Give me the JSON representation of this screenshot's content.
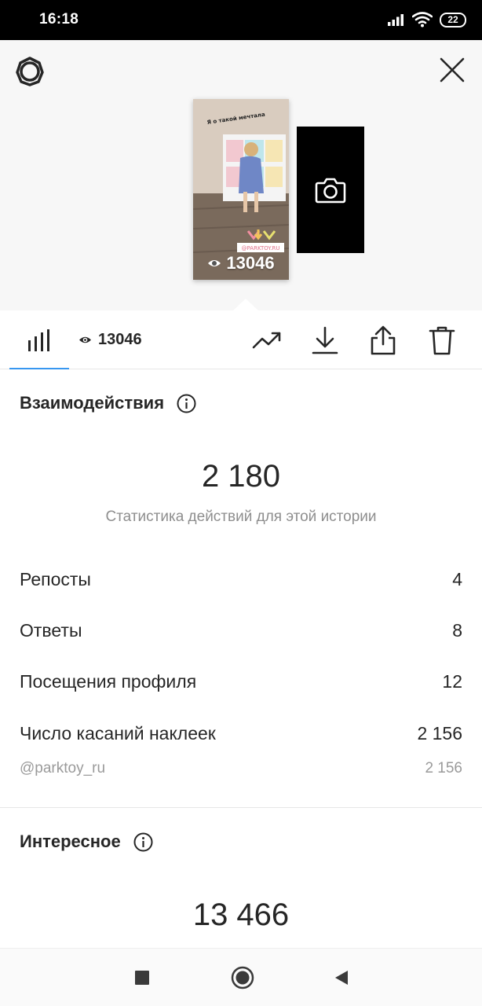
{
  "status_bar": {
    "time": "16:18",
    "battery": "22",
    "icons": [
      "signal-icon",
      "wifi-icon",
      "battery-icon"
    ]
  },
  "preview": {
    "story_views": "13046",
    "sticker_text": "@PARKTOY.RU",
    "caption_text": "Я о такой мечтала",
    "settings_icon": "gear-icon",
    "close_icon": "close-icon",
    "add_icon": "camera-icon"
  },
  "toolbar": {
    "stats_icon": "bar-chart-icon",
    "views_icon": "eye-icon",
    "views_count": "13046",
    "actions": [
      "trending-icon",
      "download-icon",
      "share-icon",
      "trash-icon"
    ]
  },
  "interactions": {
    "title": "Взаимодействия",
    "total": "2 180",
    "subtitle": "Статистика действий для этой истории",
    "rows": [
      {
        "label": "Репосты",
        "value": "4"
      },
      {
        "label": "Ответы",
        "value": "8"
      },
      {
        "label": "Посещения профиля",
        "value": "12"
      },
      {
        "label": "Число касаний наклеек",
        "value": "2 156"
      }
    ],
    "sticker_row": {
      "label": "@parktoy_ru",
      "value": "2 156"
    }
  },
  "discovery": {
    "title": "Интересное",
    "total": "13 466"
  },
  "colors": {
    "accent": "#3897f0",
    "text": "#262626",
    "secondary": "#8e8e8e"
  }
}
